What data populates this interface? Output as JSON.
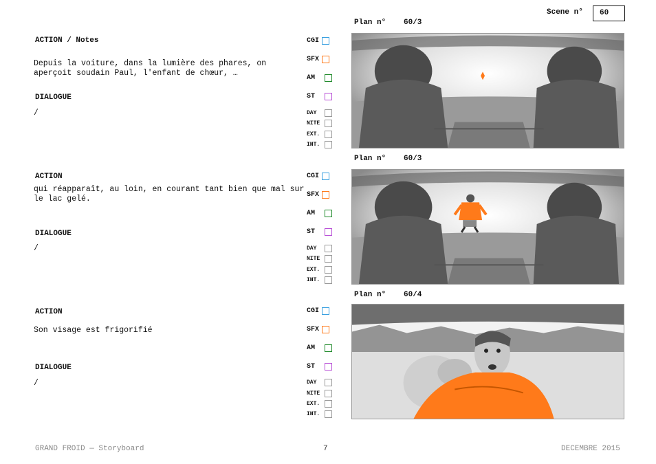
{
  "scene": {
    "label": "Scene n°",
    "number": "60"
  },
  "tags": {
    "cgi": "CGI",
    "sfx": "SFX",
    "am": "AM",
    "st": "ST",
    "day": "DAY",
    "nite": "NITE",
    "ext": "EXT.",
    "int": "INT.",
    "colors": {
      "cgi": "#3aa0e0",
      "sfx": "#ff7a1a",
      "am": "#1f8a2a",
      "st": "#b84fd6"
    }
  },
  "panels": [
    {
      "action_label": "ACTION / Notes",
      "action_text": "Depuis la voiture, dans la lumière des phares, on aperçoit soudain Paul, l'enfant de chœur, …",
      "dialogue_label": "DIALOGUE",
      "dialogue_text": "/",
      "plan_label": "Plan n°",
      "plan_number": "60/3",
      "image": "car-interior-headlights-sketch"
    },
    {
      "action_label": "ACTION",
      "action_text": "qui réapparaît, au loin, en courant tant bien que mal sur le lac gelé.",
      "dialogue_label": "DIALOGUE",
      "dialogue_text": "/",
      "plan_label": "Plan n°",
      "plan_number": "60/3",
      "image": "car-interior-boy-running-sketch"
    },
    {
      "action_label": "ACTION",
      "action_text": "Son visage est frigorifié",
      "dialogue_label": "DIALOGUE",
      "dialogue_text": "/",
      "plan_label": "Plan n°",
      "plan_number": "60/4",
      "image": "boy-face-closeup-sketch"
    }
  ],
  "footer": {
    "left": "GRAND FROID — Storyboard",
    "page": "7",
    "right": "DECEMBRE 2015"
  }
}
